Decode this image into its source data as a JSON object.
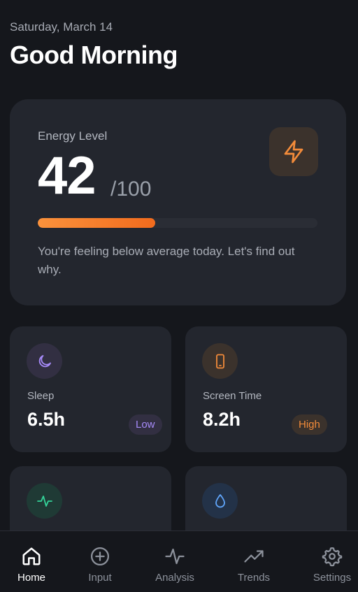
{
  "header": {
    "date": "Saturday, March 14",
    "greeting": "Good Morning"
  },
  "energy": {
    "label": "Energy Level",
    "value": "42",
    "max_label": "/100",
    "progress_percent": 42,
    "message": "You're feeling below average today. Let's find out why.",
    "icon": "lightning-icon",
    "accent_color": "#f28b3a"
  },
  "stats": [
    {
      "label": "Sleep",
      "value": "6.5h",
      "badge": "Low",
      "icon": "moon-icon",
      "color": "#a78bfa"
    },
    {
      "label": "Screen Time",
      "value": "8.2h",
      "badge": "High",
      "icon": "phone-icon",
      "color": "#f28b3a"
    },
    {
      "label": "",
      "value": "",
      "badge": "",
      "icon": "activity-icon",
      "color": "#34d399"
    },
    {
      "label": "",
      "value": "",
      "badge": "",
      "icon": "droplet-icon",
      "color": "#60a5fa"
    }
  ],
  "tabs": [
    {
      "label": "Home",
      "icon": "home-icon",
      "active": true
    },
    {
      "label": "Input",
      "icon": "plus-circle-icon",
      "active": false
    },
    {
      "label": "Analysis",
      "icon": "activity-icon",
      "active": false
    },
    {
      "label": "Trends",
      "icon": "trending-up-icon",
      "active": false
    },
    {
      "label": "Settings",
      "icon": "gear-icon",
      "active": false
    }
  ]
}
